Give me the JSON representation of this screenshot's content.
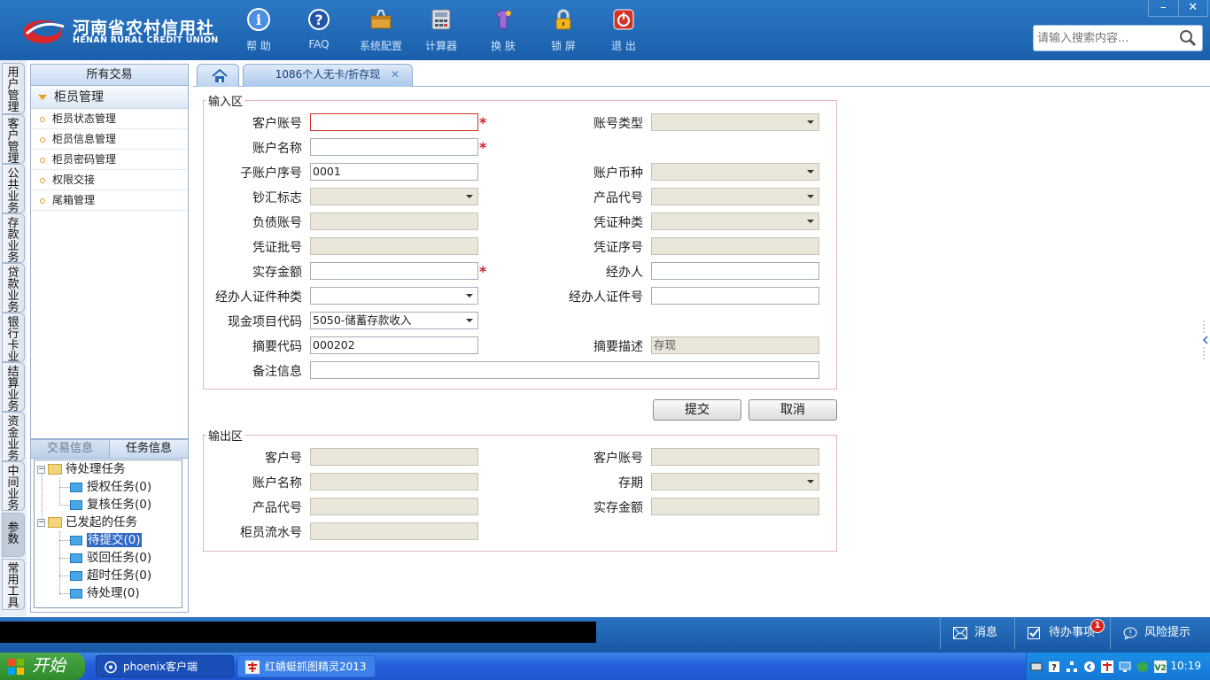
{
  "header": {
    "logo_cn": "河南省农村信用社",
    "logo_en": "HENAN RURAL CREDIT UNION",
    "tools": [
      {
        "label": "帮 助",
        "icon": "help-icon"
      },
      {
        "label": "FAQ",
        "icon": "faq-icon"
      },
      {
        "label": "系统配置",
        "icon": "toolbox-icon"
      },
      {
        "label": "计算器",
        "icon": "calculator-icon"
      },
      {
        "label": "换 肤",
        "icon": "skin-icon"
      },
      {
        "label": "锁 屏",
        "icon": "lock-icon"
      },
      {
        "label": "退 出",
        "icon": "power-icon"
      }
    ],
    "search_placeholder": "请输入搜索内容...",
    "win_min": "–",
    "win_close": "✕"
  },
  "vtabs": [
    "用户管理",
    "客户管理",
    "公共业务",
    "存款业务",
    "贷款业务",
    "银行卡业务",
    "结算业务",
    "资金业务",
    "中间业务",
    "参数",
    "常用工具"
  ],
  "menu": {
    "title": "所有交易",
    "group": "柜员管理",
    "items": [
      "柜员状态管理",
      "柜员信息管理",
      "柜员密码管理",
      "权限交接",
      "尾箱管理"
    ]
  },
  "tasks": {
    "tabs": [
      "交易信息",
      "任务信息"
    ],
    "pending": "待处理任务",
    "auth": "授权任务(0)",
    "review": "复核任务(0)",
    "initiated": "已发起的任务",
    "to_submit": "待提交(0)",
    "rejected": "驳回任务(0)",
    "timeout": "超时任务(0)",
    "to_process": "待处理(0)"
  },
  "tabs": {
    "active": "1086个人无卡/折存现",
    "close": "✕"
  },
  "input": {
    "legend": "输入区",
    "customer_account": {
      "label": "客户账号",
      "value": ""
    },
    "account_type": {
      "label": "账号类型",
      "value": ""
    },
    "account_name": {
      "label": "账户名称",
      "value": ""
    },
    "sub_account_no": {
      "label": "子账户序号",
      "value": "0001"
    },
    "currency": {
      "label": "账户币种",
      "value": ""
    },
    "cash_flag": {
      "label": "钞汇标志",
      "value": ""
    },
    "product_code": {
      "label": "产品代号",
      "value": ""
    },
    "liability_account": {
      "label": "负债账号",
      "value": ""
    },
    "voucher_type": {
      "label": "凭证种类",
      "value": ""
    },
    "voucher_batch": {
      "label": "凭证批号",
      "value": ""
    },
    "voucher_seq": {
      "label": "凭证序号",
      "value": ""
    },
    "deposit_amount": {
      "label": "实存金额",
      "value": ""
    },
    "handler": {
      "label": "经办人",
      "value": ""
    },
    "handler_id_type": {
      "label": "经办人证件种类",
      "value": ""
    },
    "handler_id_no": {
      "label": "经办人证件号",
      "value": ""
    },
    "cash_item_code": {
      "label": "现金项目代码",
      "value": "5050-储蓄存款收入"
    },
    "summary_code": {
      "label": "摘要代码",
      "value": "000202"
    },
    "summary_desc": {
      "label": "摘要描述",
      "value": "存现"
    },
    "remark": {
      "label": "备注信息",
      "value": ""
    },
    "required_mark": "*"
  },
  "buttons": {
    "submit": "提交",
    "cancel": "取消"
  },
  "output": {
    "legend": "输出区",
    "customer_no": "客户号",
    "customer_account": "客户账号",
    "account_name": "账户名称",
    "term": "存期",
    "product_code": "产品代号",
    "deposit_amount": "实存金额",
    "teller_serial": "柜员流水号"
  },
  "statusbar": {
    "message": "消息",
    "todo": "待办事项",
    "todo_count": "1",
    "risk": "风险提示"
  },
  "taskbar": {
    "start": "开始",
    "app1": "phoenix客户端",
    "app2": "红蜻蜓抓图精灵2013",
    "clock": "10:19"
  },
  "colors": {
    "header_blue": "#1f66b3",
    "required_red": "#d1202a",
    "disabled_field": "#ebe6da"
  }
}
